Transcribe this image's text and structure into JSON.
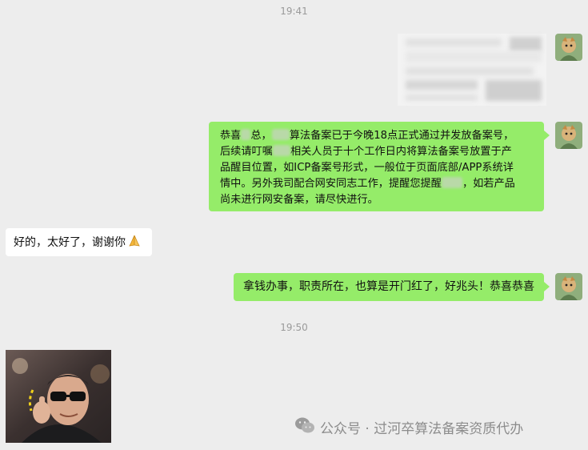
{
  "timestamps": [
    "19:41",
    "19:50"
  ],
  "messages": {
    "m2_parts": [
      "恭喜",
      "总，",
      "算法备案已于今晚18点正式通过并发放备案号，",
      "后续请叮嘱",
      "相关人员于十个工作日内将算法备案号放置于产",
      "品醒目位置，如ICP备案号形式，一般位于页面底部/APP系统详",
      "情中。另外我司配合网安同志工作，提醒您提醒",
      "，如若产品",
      "尚未进行网安备案，请尽快进行。"
    ],
    "m3": "好的，太好了，谢谢你",
    "m4": "拿钱办事，职责所在，也算是开门红了，好兆头！恭喜恭喜"
  },
  "watermark": "公众号 · 过河卒算法备案资质代办",
  "icons": {
    "avatar": "avatar-icon",
    "emoji": "pray-hands-emoji",
    "wechat": "wechat-icon"
  },
  "colors": {
    "background": "#ededed",
    "sent_bubble": "#95ec69",
    "received_bubble": "#ffffff",
    "timestamp": "#9a9a9a",
    "watermark": "#8c8c8c"
  }
}
